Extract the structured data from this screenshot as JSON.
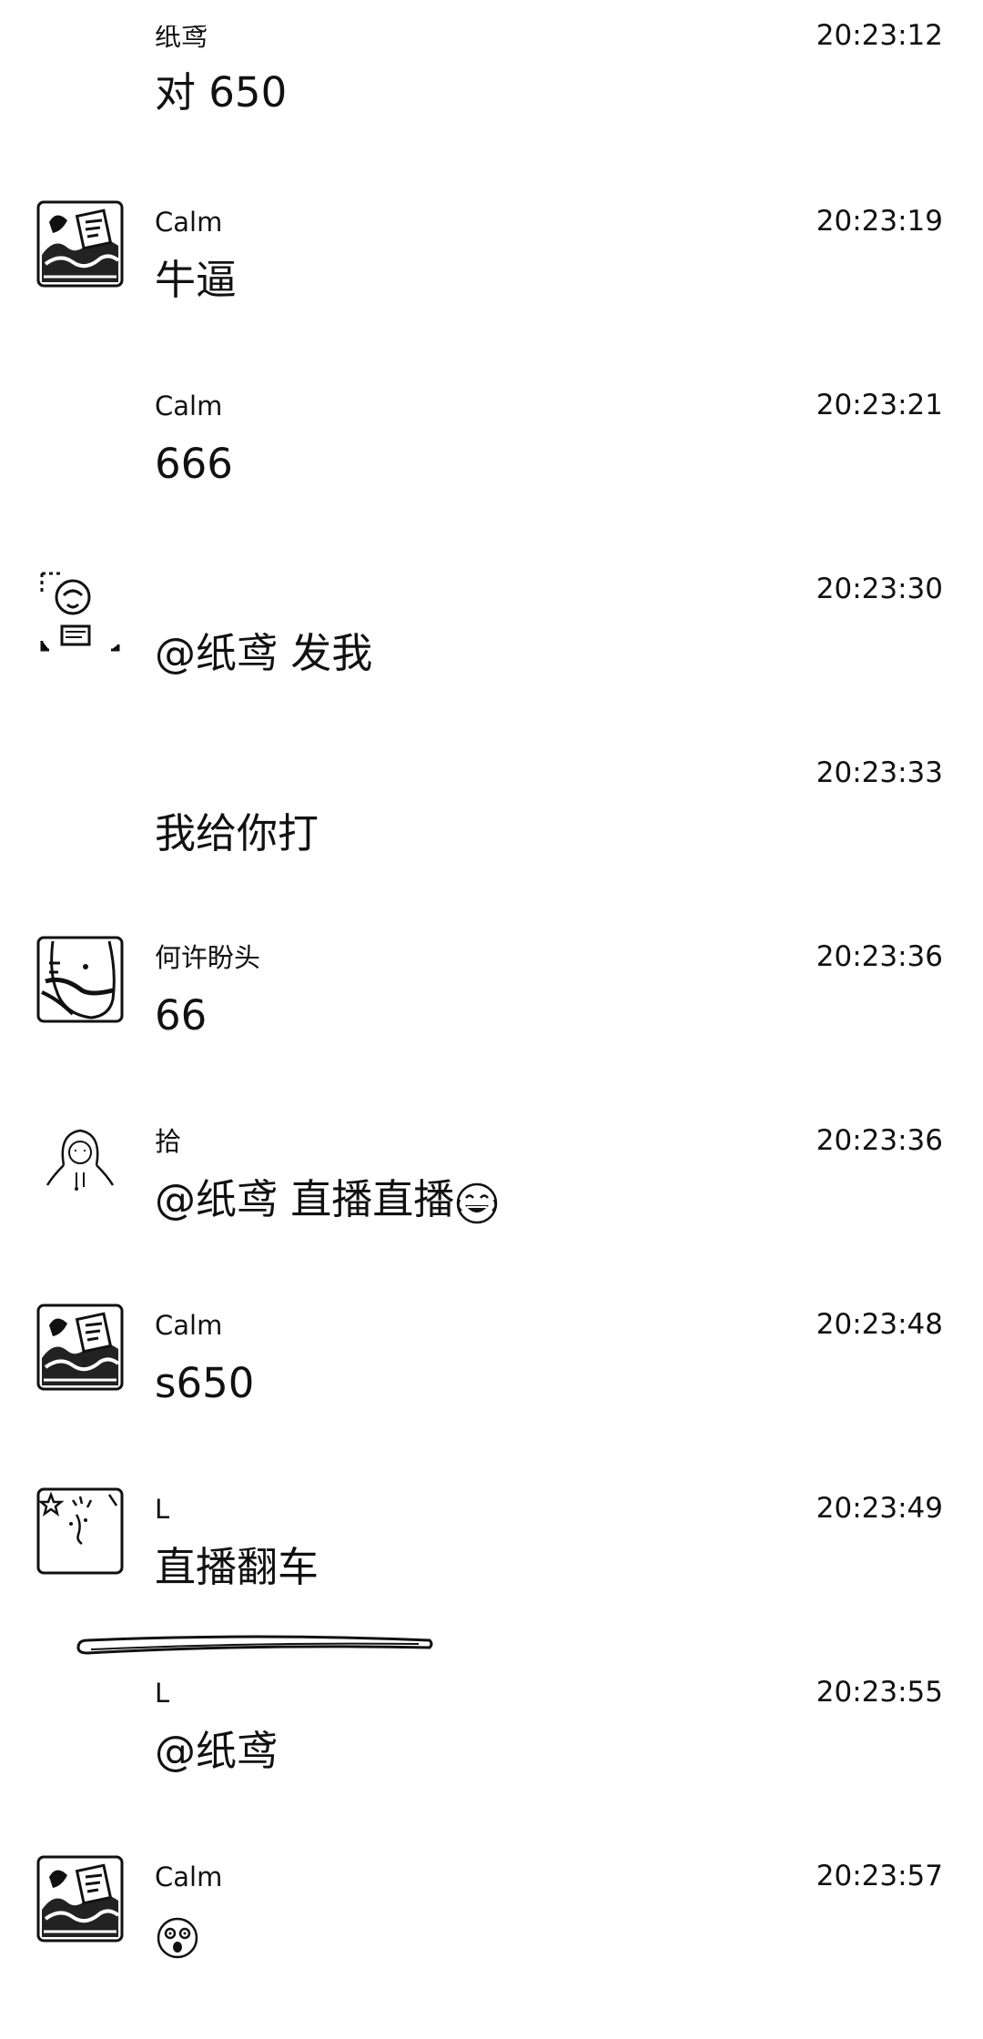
{
  "messages": [
    {
      "sender": "纸鸢",
      "time": "20:23:12",
      "text": "对 650",
      "avatar": "none"
    },
    {
      "sender": "Calm",
      "time": "20:23:19",
      "text": "牛逼",
      "avatar": "calm-avatar"
    },
    {
      "sender": "Calm",
      "time": "20:23:21",
      "text": "666",
      "avatar": "none"
    },
    {
      "sender": "",
      "time": "20:23:30",
      "text": "@纸鸢 发我",
      "avatar": "sketch-avatar"
    },
    {
      "sender": "",
      "time": "20:23:33",
      "text": "我给你打",
      "avatar": "none"
    },
    {
      "sender": "何许盼头",
      "time": "20:23:36",
      "text": "66",
      "avatar": "torso-avatar"
    },
    {
      "sender": "拾",
      "time": "20:23:36",
      "text": "@纸鸢 直播直播",
      "emoji": "laughing-tears-emoji",
      "avatar": "hoodie-avatar"
    },
    {
      "sender": "Calm",
      "time": "20:23:48",
      "text": "s650",
      "avatar": "calm-avatar"
    },
    {
      "sender": "L",
      "time": "20:23:49",
      "text": "直播翻车",
      "avatar": "star-avatar"
    },
    {
      "sender": "L",
      "time": "20:23:55",
      "text": "@纸鸢",
      "avatar": "none"
    },
    {
      "sender": "Calm",
      "time": "20:23:57",
      "text": "",
      "emoji": "shocked-face-emoji",
      "avatar": "calm-avatar"
    }
  ]
}
